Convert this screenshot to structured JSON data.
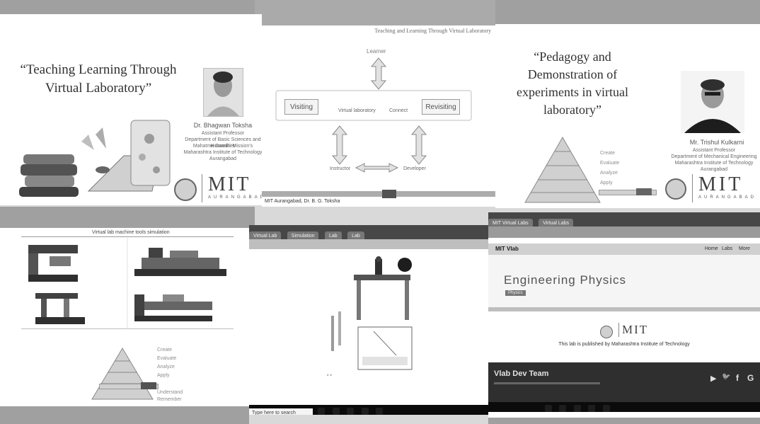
{
  "slide1": {
    "title": "“Teaching Learning Through Virtual Laboratory”",
    "speaker_name": "Dr. Bhagwan Toksha",
    "speaker_lines": [
      "Assistant Professor",
      "Department of Basic Sciences and Humanities",
      "Mahatma Gandhi Mission's",
      "Maharashtra Institute of Technology",
      "Aurangabad"
    ],
    "logo_text": "MIT",
    "logo_sub": "AURANGABAD"
  },
  "slide2": {
    "header": "Teaching and Learning Through Virtual Laboratory",
    "top_node": "Learner",
    "left_box": "Visiting",
    "middle_label": "Virtual laboratory",
    "connect_label": "Connect",
    "right_box": "Revisiting",
    "bottom_left": "Instructor",
    "bottom_right": "Developer",
    "footer": "MIT Aurangabad, Dr. B. G. Toksha"
  },
  "slide3": {
    "title": "“Pedagogy and Demonstration of experiments in virtual laboratory”",
    "pyramid_labels": [
      "Create",
      "Evaluate",
      "Analyze",
      "Apply"
    ],
    "speaker_name": "Mr. Trishul Kulkarni",
    "speaker_lines": [
      "Assistant Professor",
      "Department of Mechanical Engineering",
      "Maharashtra Institute of Technology",
      "Aurangabad"
    ],
    "logo_text": "MIT",
    "logo_sub": "AURANGABAD"
  },
  "panel4": {
    "header": "Virtual lab machine tools simulation",
    "pyramid_labels": [
      "Create",
      "Evaluate",
      "Analyze",
      "Apply",
      "Understand",
      "Remember"
    ]
  },
  "panel5": {
    "tabs": [
      "Virtual Lab",
      "Simulation",
      "Lab",
      "Lab"
    ],
    "taskbar_search": "Type here to search"
  },
  "panel6": {
    "tabs": [
      "MIT Virtual Labs",
      "Virtual Labs"
    ],
    "nav_label": "MIT Vlab",
    "nav_links": [
      "Home",
      "Labs",
      "More"
    ],
    "page_title": "Engineering Physics",
    "badge": "Physics",
    "logo_text": "MIT",
    "published_by": "This lab is published by Maharashtra Institute of Technology",
    "team_label": "Vlab Dev Team",
    "social": [
      "▶",
      "🐦",
      "f",
      "G"
    ]
  }
}
